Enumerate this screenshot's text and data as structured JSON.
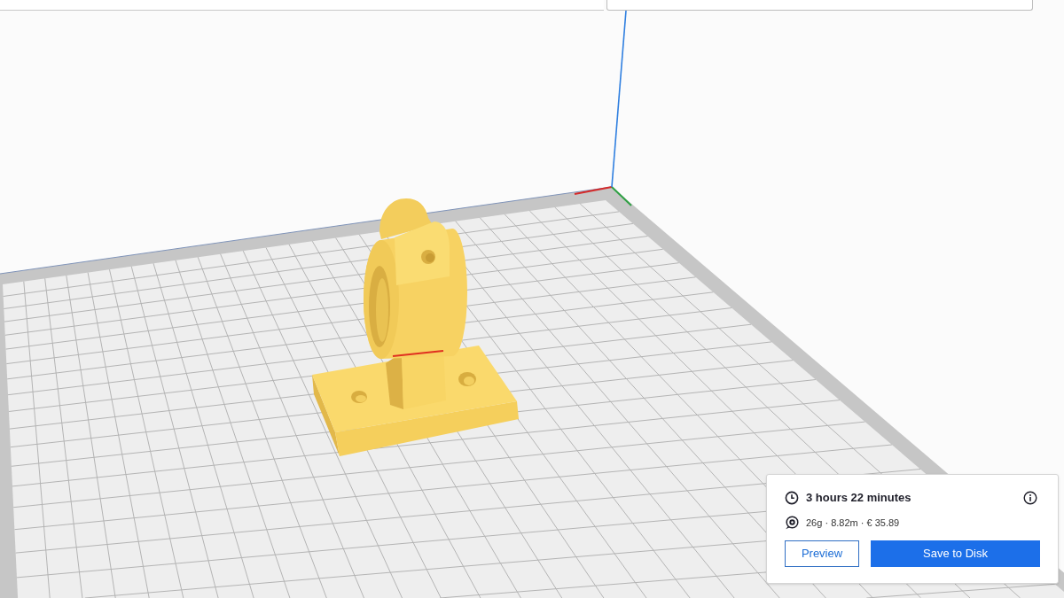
{
  "print_summary": {
    "time": "3 hours 22 minutes",
    "material": "26g · 8.82m · € 35.89",
    "buttons": [
      {
        "label": "Preview",
        "kind": "secondary"
      },
      {
        "label": "Save to Disk",
        "kind": "primary"
      }
    ]
  }
}
